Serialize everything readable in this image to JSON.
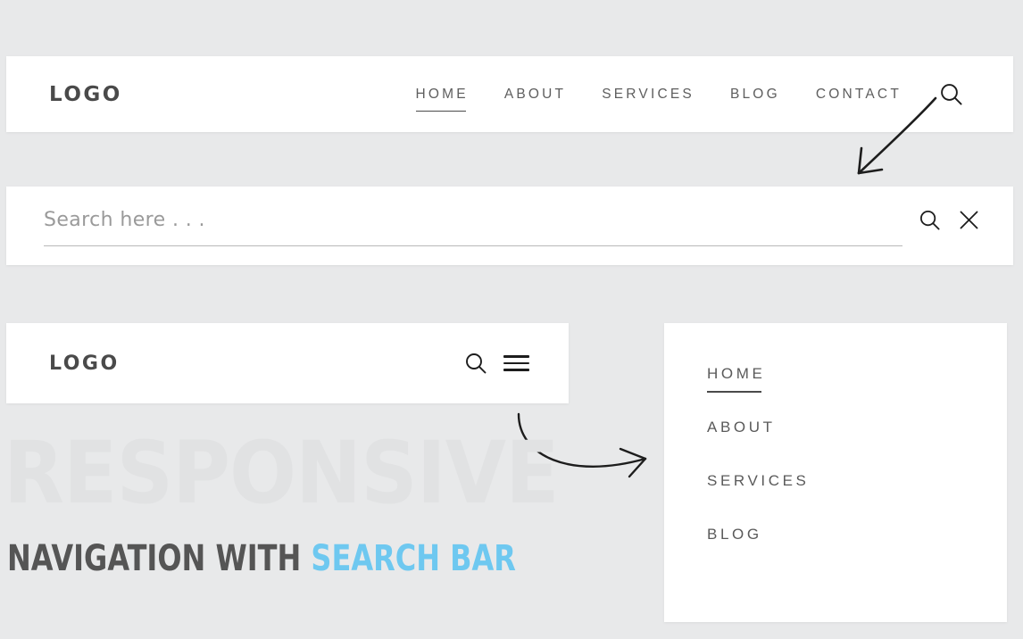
{
  "page": {
    "background_color": "#e8e9ea",
    "watermark_text": "RESPONSIVE",
    "headline_dark": "NAVIGATION WITH ",
    "headline_blue": "SEARCH BAR",
    "accent_color": "#6ec8f0",
    "text_color": "#555555"
  },
  "desktop_header": {
    "logo": "LOGO",
    "nav_items": [
      {
        "label": "HOME",
        "active": true
      },
      {
        "label": "ABOUT",
        "active": false
      },
      {
        "label": "SERVICES",
        "active": false
      },
      {
        "label": "BLOG",
        "active": false
      },
      {
        "label": "CONTACT",
        "active": false
      }
    ],
    "search_icon": "search-icon"
  },
  "search_bar": {
    "placeholder": "Search here . . .",
    "value": "",
    "search_icon": "search-icon",
    "close_icon": "close-icon"
  },
  "mobile_header": {
    "logo": "LOGO",
    "search_icon": "search-icon",
    "menu_icon": "hamburger-icon"
  },
  "dropdown_menu": {
    "items": [
      {
        "label": "HOME",
        "active": true
      },
      {
        "label": "ABOUT",
        "active": false
      },
      {
        "label": "SERVICES",
        "active": false
      },
      {
        "label": "BLOG",
        "active": false
      }
    ]
  },
  "annotations": {
    "arrow_to_search_bar": "arrow-down-left-icon",
    "arrow_to_dropdown": "arrow-curved-right-icon"
  }
}
